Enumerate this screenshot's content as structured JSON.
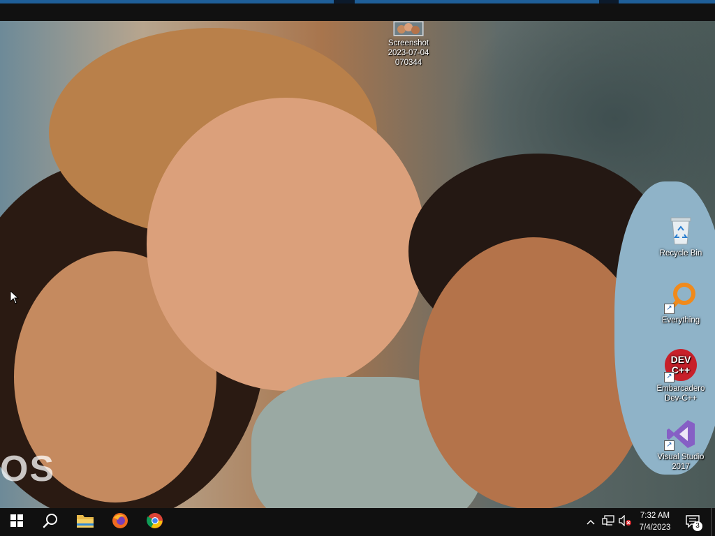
{
  "desktop": {
    "icons": [
      {
        "name": "screenshot-file-icon",
        "label_lines": [
          "Screenshot",
          "2023-07-04",
          "070344"
        ]
      },
      {
        "name": "recycle-bin-icon",
        "label_lines": [
          "Recycle Bin"
        ]
      },
      {
        "name": "everything-icon",
        "label_lines": [
          "Everything"
        ]
      },
      {
        "name": "dev-cpp-icon",
        "label_lines": [
          "Embarcadero",
          "Dev-C++"
        ],
        "badge_lines": [
          "DEV",
          "C++"
        ]
      },
      {
        "name": "visual-studio-icon",
        "label_lines": [
          "Visual Studio",
          "2017"
        ]
      }
    ],
    "wallpaper_text": "OS"
  },
  "taskbar": {
    "pinned": [
      "start-icon",
      "search-icon",
      "file-explorer-icon",
      "firefox-icon",
      "chrome-icon"
    ],
    "tray_icons": [
      "chevron-up-icon",
      "network-icon",
      "volume-muted-icon"
    ],
    "clock": {
      "time": "7:32 AM",
      "date": "7/4/2023"
    },
    "notification_count": "3"
  },
  "colors": {
    "taskbar_bg": "#101010",
    "accent": "#1f5f99",
    "devcpp_red": "#c8202a",
    "vs_purple": "#865fc5",
    "everything_orange": "#f08a1c"
  }
}
